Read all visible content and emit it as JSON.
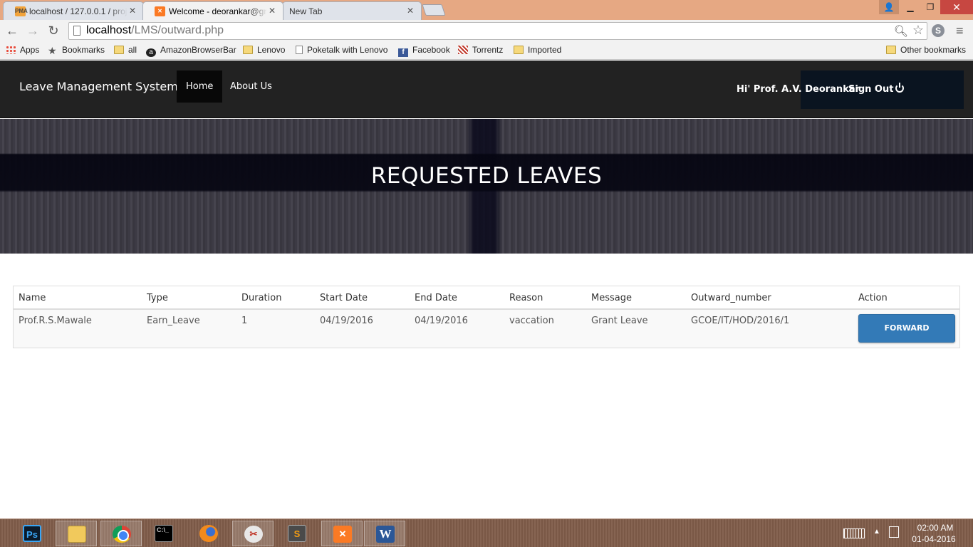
{
  "browser": {
    "tabs": [
      {
        "title": "localhost / 127.0.0.1 / proj",
        "favicon": "phpmyadmin-icon",
        "active": false
      },
      {
        "title": "Welcome - deorankar@gr",
        "favicon": "xampp-icon",
        "active": true
      },
      {
        "title": "New Tab",
        "favicon": "",
        "active": false
      }
    ],
    "url_host": "localhost",
    "url_path": "/LMS/outward.php",
    "bookmarks": [
      {
        "label": "Apps",
        "icon": "apps-icon"
      },
      {
        "label": "Bookmarks",
        "icon": "star-icon"
      },
      {
        "label": "all",
        "icon": "folder-icon"
      },
      {
        "label": "AmazonBrowserBar",
        "icon": "amazon-icon"
      },
      {
        "label": "Lenovo",
        "icon": "folder-icon"
      },
      {
        "label": "Poketalk with Lenovo",
        "icon": "page-icon"
      },
      {
        "label": "Facebook",
        "icon": "facebook-icon"
      },
      {
        "label": "Torrentz",
        "icon": "torrentz-icon"
      },
      {
        "label": "Imported",
        "icon": "folder-icon"
      }
    ],
    "other_bookmarks": "Other bookmarks"
  },
  "site": {
    "brand": "Leave Management System",
    "nav": {
      "home": "Home",
      "about": "About Us"
    },
    "greeting": "Hi' Prof. A.V. Deorankar",
    "signout": "Sign Out",
    "hero_title": "REQUESTED LEAVES",
    "table": {
      "headers": [
        "Name",
        "Type",
        "Duration",
        "Start Date",
        "End Date",
        "Reason",
        "Message",
        "Outward_number",
        "Action"
      ],
      "rows": [
        {
          "name": "Prof.R.S.Mawale",
          "type": "Earn_Leave",
          "duration": "1",
          "start_date": "04/19/2016",
          "end_date": "04/19/2016",
          "reason": "vaccation",
          "message": "Grant Leave",
          "outward_number": "GCOE/IT/HOD/2016/1",
          "action": "FORWARD"
        }
      ]
    },
    "colors": {
      "navbar": "#222222",
      "button": "#337ab7"
    }
  },
  "taskbar": {
    "apps": [
      "photoshop-icon",
      "file-explorer-icon",
      "chrome-icon",
      "command-prompt-icon",
      "firefox-icon",
      "snipping-tool-icon",
      "sublime-text-icon",
      "xampp-icon",
      "word-icon"
    ],
    "time": "02:00 AM",
    "date": "01-04-2016"
  }
}
